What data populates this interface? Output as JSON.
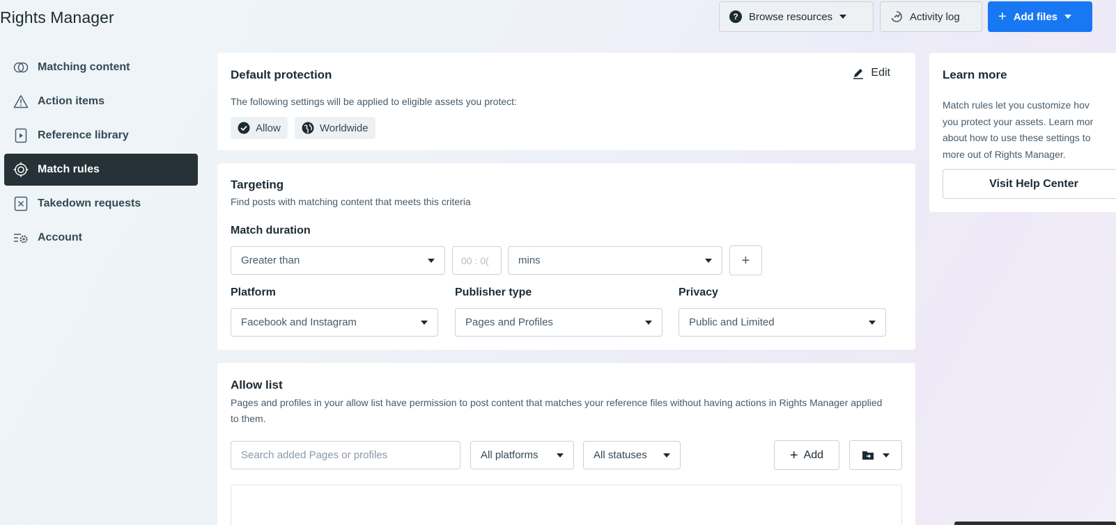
{
  "app": {
    "title": "Rights Manager"
  },
  "header": {
    "browse_resources": "Browse resources",
    "activity_log": "Activity log",
    "add_files": "Add files",
    "brand_color": "#1877f2"
  },
  "sidebar": {
    "items": [
      {
        "label": "Matching content",
        "icon": "matching-content-icon",
        "active": false
      },
      {
        "label": "Action items",
        "icon": "warning-icon",
        "active": false
      },
      {
        "label": "Reference library",
        "icon": "reference-library-icon",
        "active": false
      },
      {
        "label": "Match rules",
        "icon": "target-icon",
        "active": true
      },
      {
        "label": "Takedown requests",
        "icon": "takedown-icon",
        "active": false
      },
      {
        "label": "Account",
        "icon": "account-settings-icon",
        "active": false
      }
    ]
  },
  "default_protection": {
    "title": "Default protection",
    "edit": "Edit",
    "description": "The following settings will be applied to eligible assets you protect:",
    "chips": [
      "Allow",
      "Worldwide"
    ]
  },
  "targeting": {
    "title": "Targeting",
    "subtitle": "Find posts with matching content that meets this criteria",
    "match_duration_label": "Match duration",
    "duration_operator": "Greater than",
    "duration_placeholder": "00 : 0(",
    "duration_unit": "mins",
    "add_symbol": "+",
    "platform_label": "Platform",
    "platform_value": "Facebook and Instagram",
    "publisher_label": "Publisher type",
    "publisher_value": "Pages and Profiles",
    "privacy_label": "Privacy",
    "privacy_value": "Public and Limited"
  },
  "allow_list": {
    "title": "Allow list",
    "description": "Pages and profiles in your allow list have permission to post content that matches your reference files without having actions in Rights Manager applied to them.",
    "search_placeholder": "Search added Pages or profiles",
    "platform_filter": "All platforms",
    "status_filter": "All statuses",
    "add": "Add"
  },
  "learn_more": {
    "title": "Learn more",
    "lines": [
      "Match rules let you customize hov",
      "you protect your assets. Learn mor",
      "about how to use these settings to",
      "more out of Rights Manager."
    ],
    "button": "Visit Help Center"
  }
}
